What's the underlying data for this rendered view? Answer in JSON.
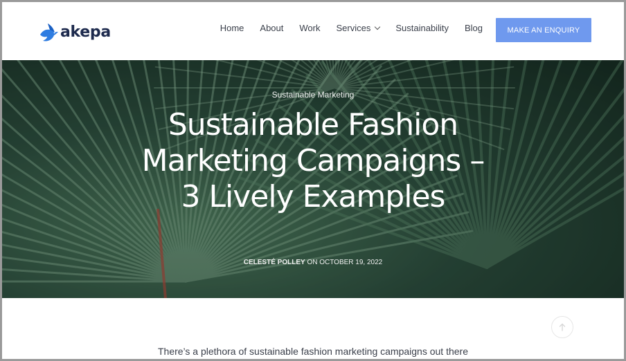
{
  "brand": {
    "name": "akepa",
    "logo_icon": "bird-icon",
    "logo_color": "#2f7de1"
  },
  "nav": {
    "items": [
      {
        "label": "Home"
      },
      {
        "label": "About"
      },
      {
        "label": "Work"
      },
      {
        "label": "Services",
        "has_dropdown": true
      },
      {
        "label": "Sustainability"
      },
      {
        "label": "Blog"
      }
    ],
    "cta_label": "MAKE AN ENQUIRY",
    "cta_color": "#6f99ee"
  },
  "hero": {
    "category": "Sustainable Marketing",
    "title": "Sustainable Fashion Marketing Campaigns – 3 Lively Examples",
    "author": "CELESTÉ POLLEY",
    "date_prefix": "ON",
    "date": "OCTOBER 19, 2022",
    "background_colors": [
      "#4f7a5d",
      "#2b4a3b",
      "#15281f"
    ]
  },
  "content": {
    "intro": "There’s a plethora of sustainable fashion marketing campaigns out there",
    "scroll_top_icon": "arrow-up-icon"
  }
}
